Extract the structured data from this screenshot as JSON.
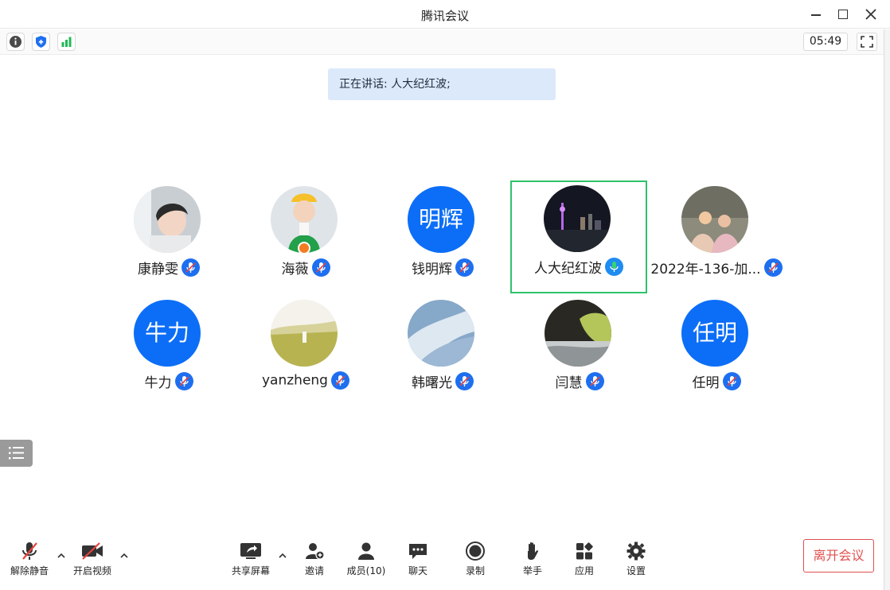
{
  "window": {
    "title": "腾讯会议"
  },
  "infobar": {
    "timer": "05:49"
  },
  "banner": {
    "speaking_text": "正在讲话: 人大纪红波;"
  },
  "participants": [
    {
      "name": "康静雯",
      "avatar_text": "",
      "mic": "muted"
    },
    {
      "name": "海薇",
      "avatar_text": "",
      "mic": "muted"
    },
    {
      "name": "钱明辉",
      "avatar_text": "明辉",
      "mic": "muted"
    },
    {
      "name": "人大纪红波",
      "avatar_text": "",
      "mic": "speaking"
    },
    {
      "name": "2022年-136-加...",
      "avatar_text": "",
      "mic": "muted"
    },
    {
      "name": "牛力",
      "avatar_text": "牛力",
      "mic": "muted"
    },
    {
      "name": "yanzheng",
      "avatar_text": "",
      "mic": "muted"
    },
    {
      "name": "韩曙光",
      "avatar_text": "",
      "mic": "muted"
    },
    {
      "name": "闫慧",
      "avatar_text": "",
      "mic": "muted"
    },
    {
      "name": "任明",
      "avatar_text": "任明",
      "mic": "muted"
    }
  ],
  "toolbar": {
    "unmute": "解除静音",
    "start_video": "开启视频",
    "share_screen": "共享屏幕",
    "invite": "邀请",
    "members": "成员(10)",
    "chat": "聊天",
    "record": "录制",
    "raise_hand": "举手",
    "apps": "应用",
    "settings": "设置",
    "leave": "离开会议"
  },
  "colors": {
    "accent": "#0c6ef7",
    "active_border": "#2fc26b",
    "leave": "#e0504f",
    "banner": "#dbe9fb"
  }
}
